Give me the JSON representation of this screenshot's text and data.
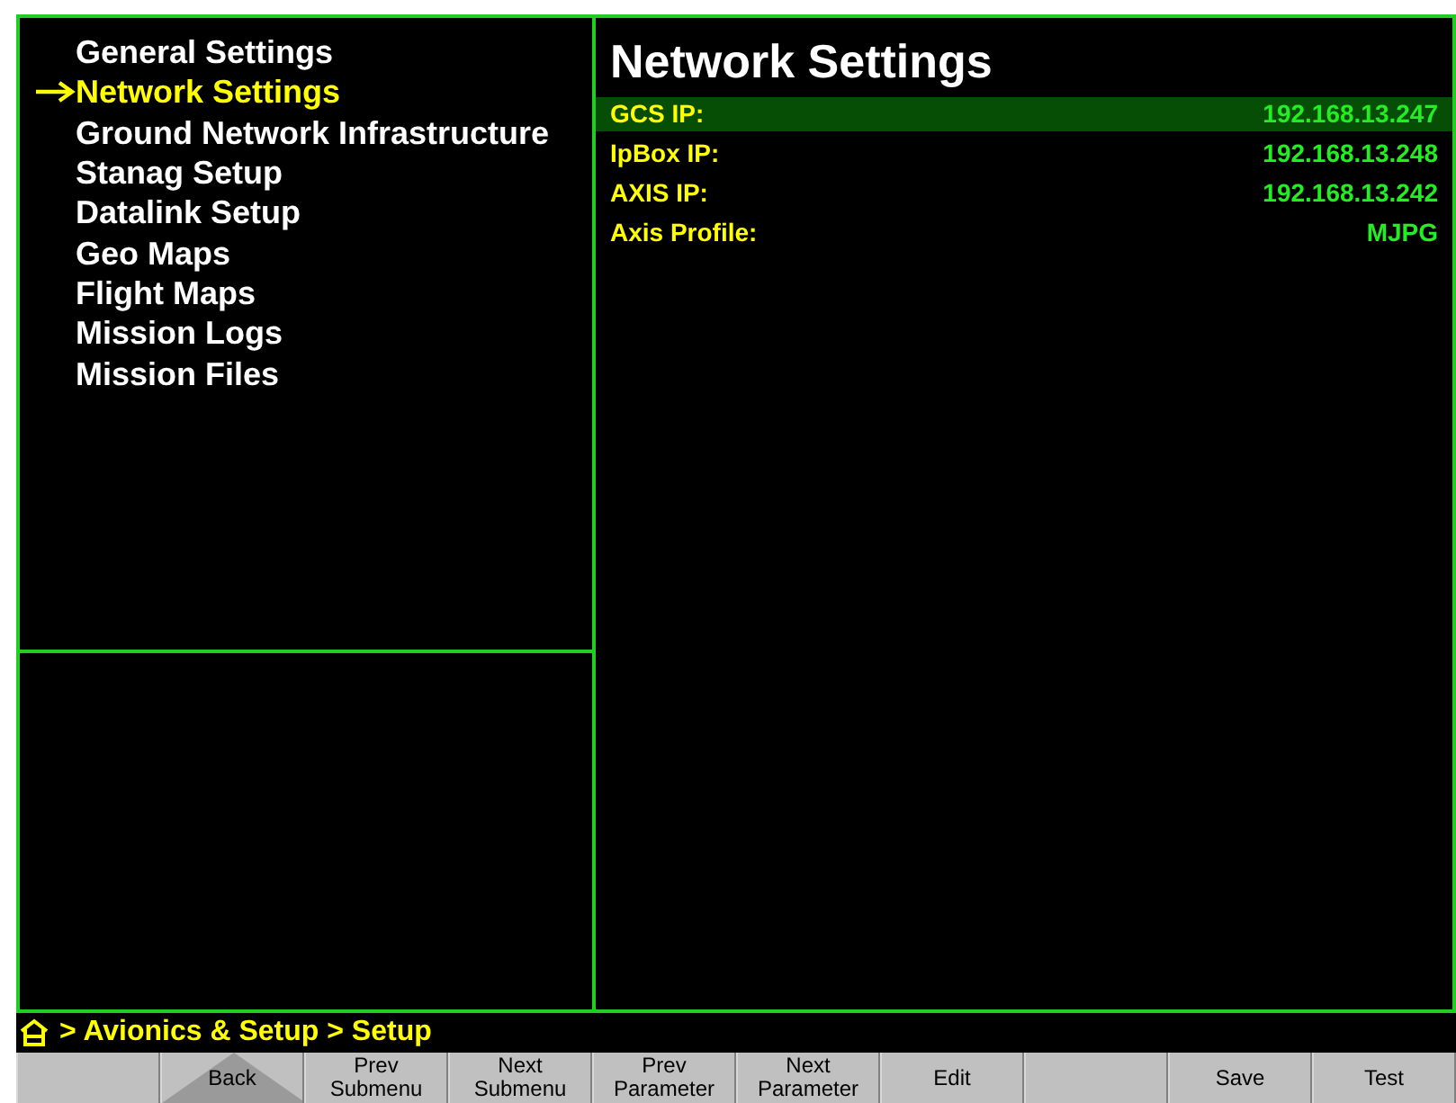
{
  "menu": {
    "items": [
      {
        "label": "General Settings",
        "selected": false
      },
      {
        "label": "Network Settings",
        "selected": true
      },
      {
        "label": "Ground Network Infrastructure",
        "selected": false
      },
      {
        "label": "Stanag Setup",
        "selected": false
      },
      {
        "label": "Datalink Setup",
        "selected": false
      },
      {
        "label": "Geo Maps",
        "selected": false
      },
      {
        "label": "Flight Maps",
        "selected": false
      },
      {
        "label": "Mission Logs",
        "selected": false
      },
      {
        "label": "Mission Files",
        "selected": false
      }
    ]
  },
  "panel": {
    "title": "Network Settings",
    "rows": [
      {
        "label": "GCS IP:",
        "value": "192.168.13.247",
        "selected": true
      },
      {
        "label": "IpBox IP:",
        "value": "192.168.13.248",
        "selected": false
      },
      {
        "label": "AXIS IP:",
        "value": "192.168.13.242",
        "selected": false
      },
      {
        "label": "Axis Profile:",
        "value": "MJPG",
        "selected": false
      }
    ]
  },
  "breadcrumb": "> Avionics & Setup > Setup",
  "softkeys": [
    {
      "kind": "blank"
    },
    {
      "kind": "back",
      "lines": [
        "Back"
      ]
    },
    {
      "kind": "key",
      "lines": [
        "Prev",
        "Submenu"
      ]
    },
    {
      "kind": "key",
      "lines": [
        "Next",
        "Submenu"
      ]
    },
    {
      "kind": "key",
      "lines": [
        "Prev",
        "Parameter"
      ]
    },
    {
      "kind": "key",
      "lines": [
        "Next",
        "Parameter"
      ]
    },
    {
      "kind": "key",
      "lines": [
        "Edit"
      ]
    },
    {
      "kind": "blank"
    },
    {
      "kind": "key",
      "lines": [
        "Save"
      ]
    },
    {
      "kind": "key",
      "lines": [
        "Test"
      ]
    }
  ]
}
